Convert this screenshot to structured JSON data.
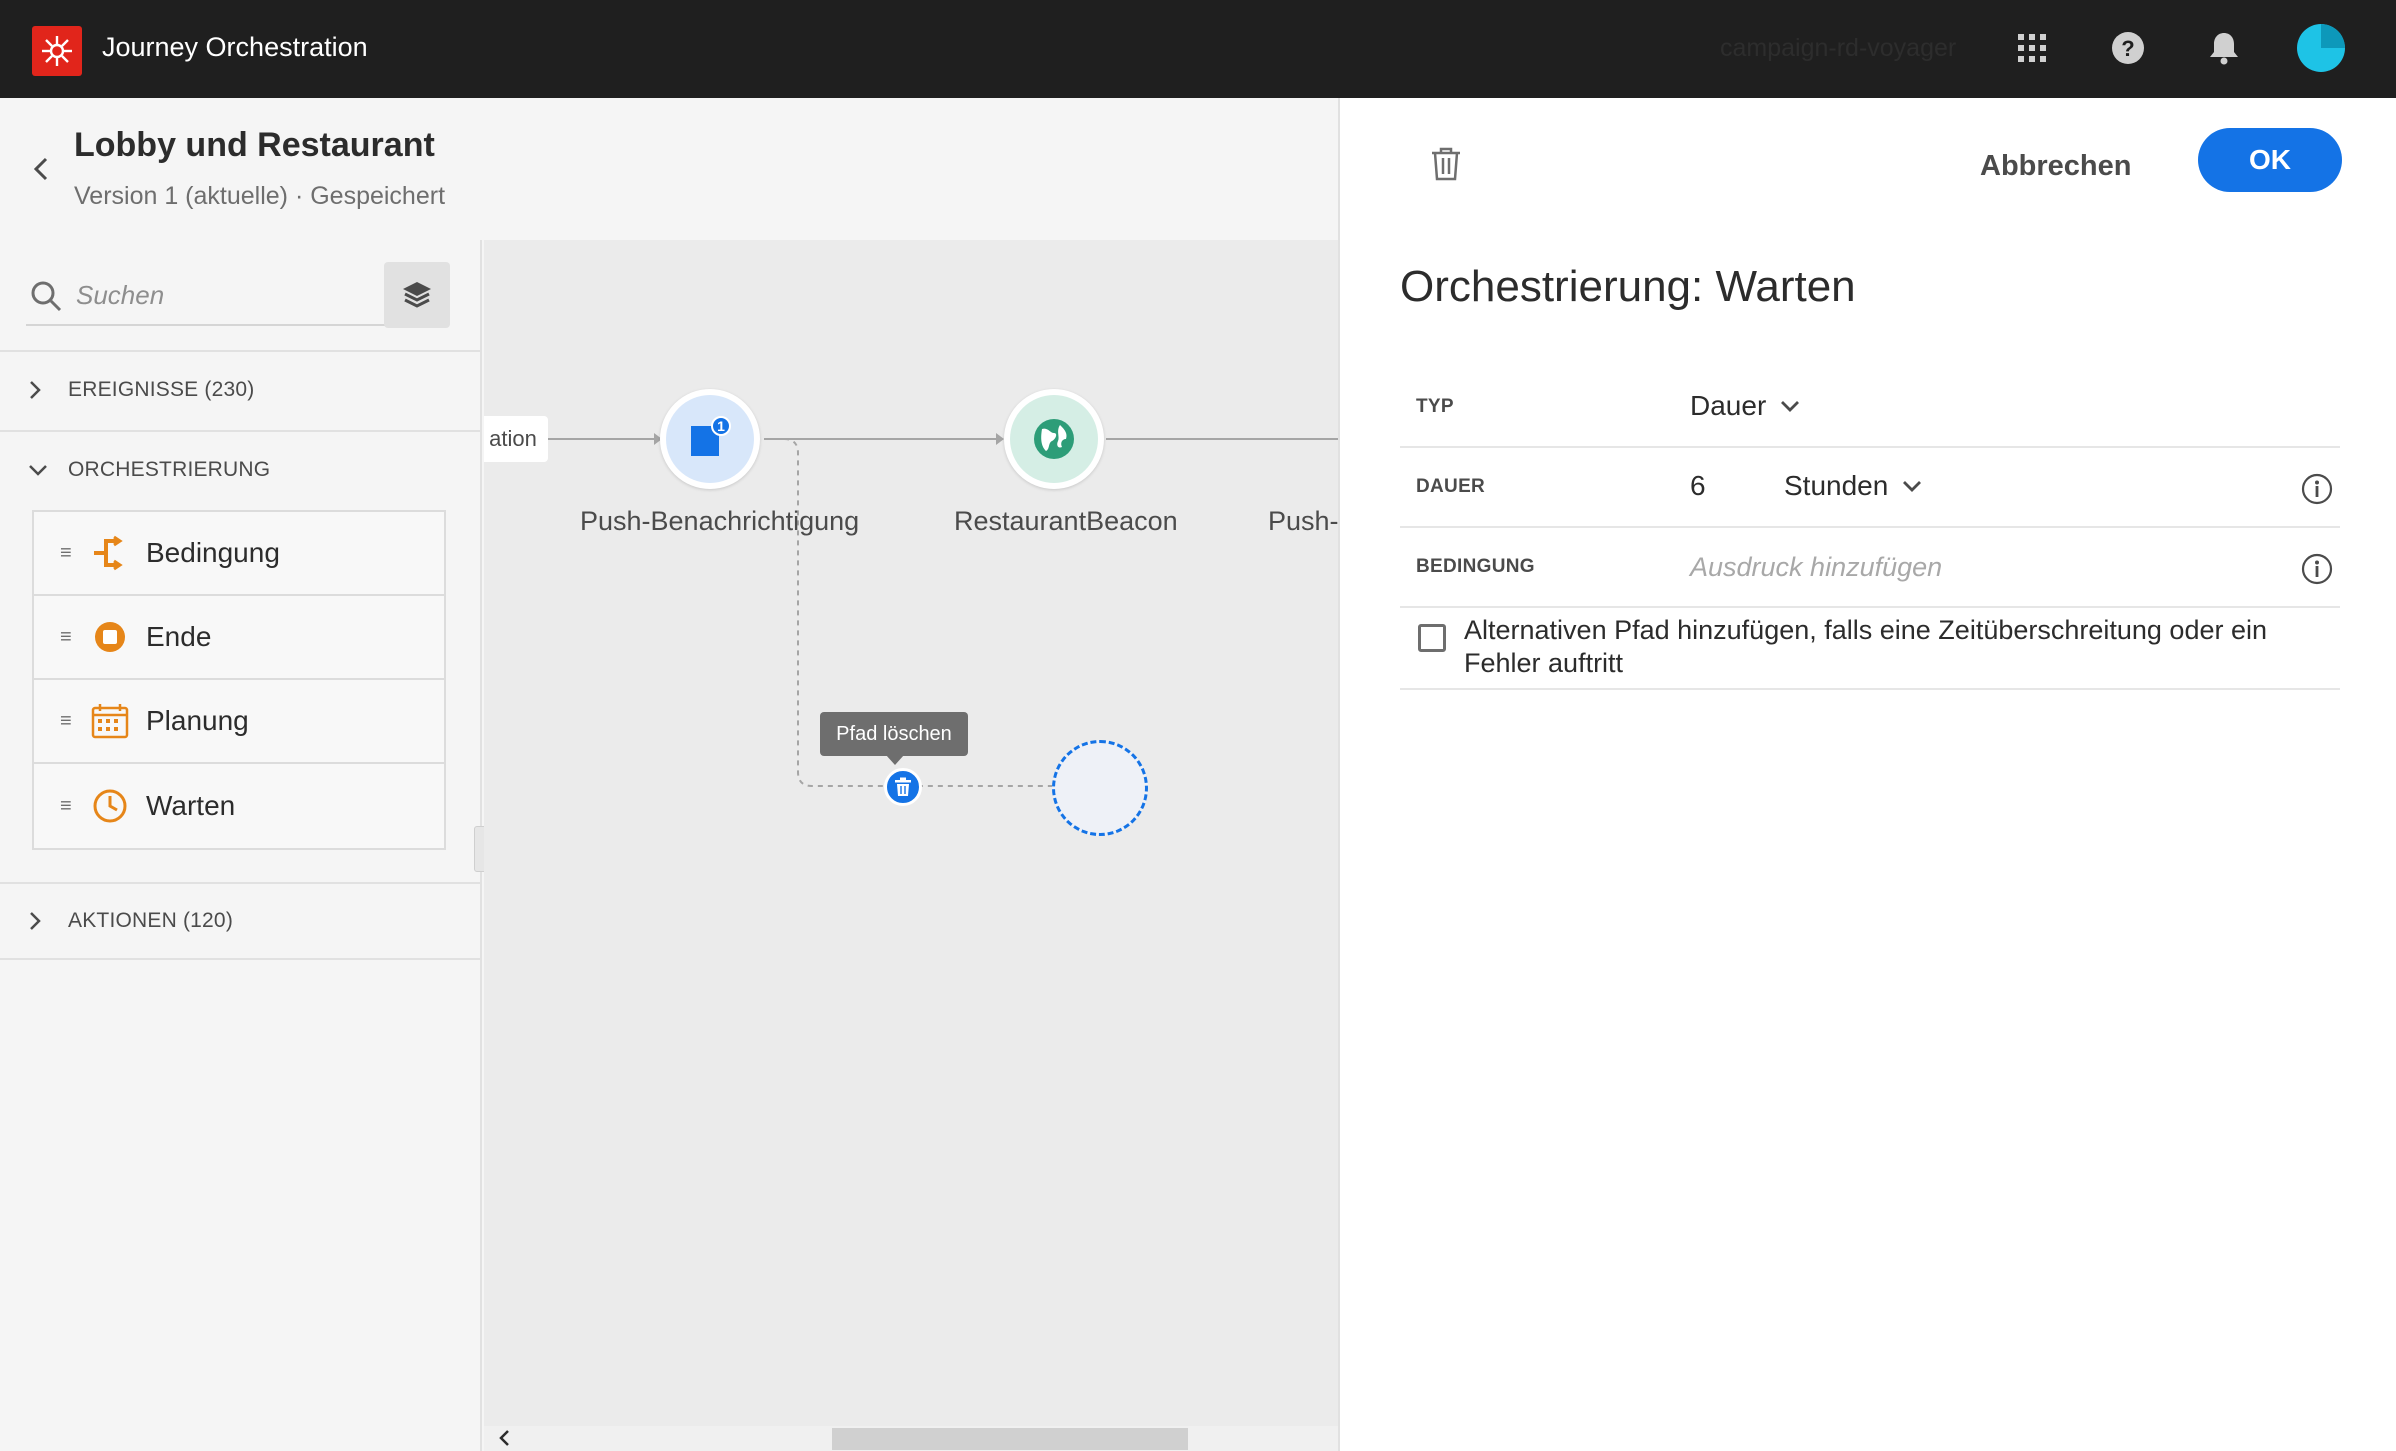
{
  "app": {
    "title": "Journey Orchestration",
    "org": "campaign-rd-voyager",
    "brand_color": "#e1251b",
    "accent": "#1473e6"
  },
  "topbar_icons": [
    "apps-grid-icon",
    "help-icon",
    "bell-icon",
    "avatar"
  ],
  "journey": {
    "title": "Lobby und Restaurant",
    "subtitle": "Version 1 (aktuelle) · Gespeichert"
  },
  "palette": {
    "search_placeholder": "Suchen",
    "sections": {
      "events": {
        "label": "EREIGNISSE (230)",
        "expanded": false
      },
      "orchestration": {
        "label": "ORCHESTRIERUNG",
        "expanded": true
      },
      "actions": {
        "label": "AKTIONEN (120)",
        "expanded": false
      }
    },
    "orchestration_items": [
      {
        "label": "Bedingung",
        "icon": "condition-icon"
      },
      {
        "label": "Ende",
        "icon": "end-icon"
      },
      {
        "label": "Planung",
        "icon": "calendar-icon"
      },
      {
        "label": "Warten",
        "icon": "clock-icon"
      }
    ]
  },
  "canvas": {
    "prev_chip": "ation",
    "nodes": [
      {
        "label": "Push-Benachrichtigung",
        "badge": "1",
        "icon": "push-notification-icon"
      },
      {
        "label": "RestaurantBeacon",
        "icon": "globe-icon"
      },
      {
        "label": "Push-B"
      }
    ],
    "tooltip": "Pfad löschen"
  },
  "panel": {
    "cancel_label": "Abbrechen",
    "ok_label": "OK",
    "title": "Orchestrierung: Warten",
    "type": {
      "label": "TYP",
      "value": "Dauer"
    },
    "duration": {
      "label": "DAUER",
      "amount": "6",
      "unit": "Stunden"
    },
    "condition": {
      "label": "BEDINGUNG",
      "placeholder": "Ausdruck hinzufügen"
    },
    "alt_path": {
      "label": "Alternativen Pfad hinzufügen, falls eine Zeitüberschreitung oder ein Fehler auftritt",
      "checked": false
    }
  }
}
